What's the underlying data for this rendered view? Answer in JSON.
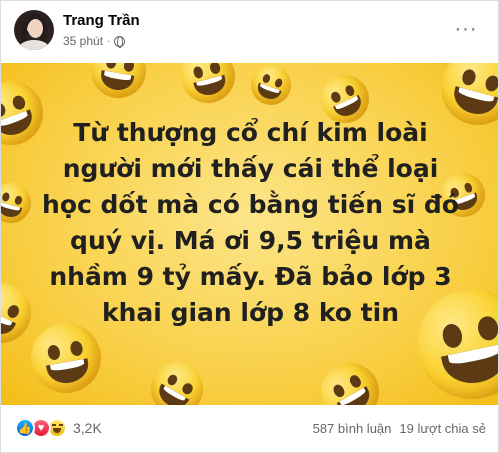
{
  "author": {
    "name": "Trang Trần",
    "time": "35 phút",
    "separator": "·",
    "privacy_icon": "globe-icon"
  },
  "menu": {
    "more_label": "···"
  },
  "post": {
    "text": "Từ thượng cổ chí kim loài người mới thấy cái thể loại học dốt mà có bằng tiến sĩ đó quý vị. Má ơi 9,5 triệu mà nhầm 9 tỷ mấy. Đã bảo lớp 3 khai gian lớp 8 ko tin",
    "background": {
      "theme": "laughing-emoji",
      "color": "#f9d24d"
    }
  },
  "reactions": {
    "icons": [
      "like-icon",
      "love-icon",
      "haha-icon"
    ],
    "count": "3,2K"
  },
  "stats": {
    "comments": "587 bình luận",
    "shares": "19 lượt chia sẻ"
  },
  "colors": {
    "text_primary": "#050505",
    "text_secondary": "#65676b",
    "like_blue": "#1877f2"
  }
}
